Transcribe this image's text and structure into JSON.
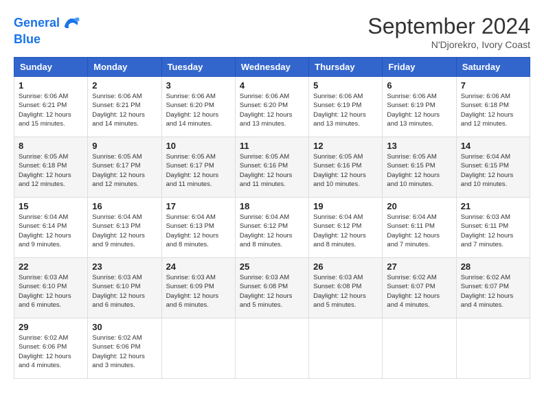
{
  "logo": {
    "line1": "General",
    "line2": "Blue"
  },
  "title": "September 2024",
  "location": "N'Djorekro, Ivory Coast",
  "days_of_week": [
    "Sunday",
    "Monday",
    "Tuesday",
    "Wednesday",
    "Thursday",
    "Friday",
    "Saturday"
  ],
  "weeks": [
    [
      {
        "day": "1",
        "sunrise": "6:06 AM",
        "sunset": "6:21 PM",
        "daylight": "12 hours and 15 minutes."
      },
      {
        "day": "2",
        "sunrise": "6:06 AM",
        "sunset": "6:21 PM",
        "daylight": "12 hours and 14 minutes."
      },
      {
        "day": "3",
        "sunrise": "6:06 AM",
        "sunset": "6:20 PM",
        "daylight": "12 hours and 14 minutes."
      },
      {
        "day": "4",
        "sunrise": "6:06 AM",
        "sunset": "6:20 PM",
        "daylight": "12 hours and 13 minutes."
      },
      {
        "day": "5",
        "sunrise": "6:06 AM",
        "sunset": "6:19 PM",
        "daylight": "12 hours and 13 minutes."
      },
      {
        "day": "6",
        "sunrise": "6:06 AM",
        "sunset": "6:19 PM",
        "daylight": "12 hours and 13 minutes."
      },
      {
        "day": "7",
        "sunrise": "6:06 AM",
        "sunset": "6:18 PM",
        "daylight": "12 hours and 12 minutes."
      }
    ],
    [
      {
        "day": "8",
        "sunrise": "6:05 AM",
        "sunset": "6:18 PM",
        "daylight": "12 hours and 12 minutes."
      },
      {
        "day": "9",
        "sunrise": "6:05 AM",
        "sunset": "6:17 PM",
        "daylight": "12 hours and 12 minutes."
      },
      {
        "day": "10",
        "sunrise": "6:05 AM",
        "sunset": "6:17 PM",
        "daylight": "12 hours and 11 minutes."
      },
      {
        "day": "11",
        "sunrise": "6:05 AM",
        "sunset": "6:16 PM",
        "daylight": "12 hours and 11 minutes."
      },
      {
        "day": "12",
        "sunrise": "6:05 AM",
        "sunset": "6:16 PM",
        "daylight": "12 hours and 10 minutes."
      },
      {
        "day": "13",
        "sunrise": "6:05 AM",
        "sunset": "6:15 PM",
        "daylight": "12 hours and 10 minutes."
      },
      {
        "day": "14",
        "sunrise": "6:04 AM",
        "sunset": "6:15 PM",
        "daylight": "12 hours and 10 minutes."
      }
    ],
    [
      {
        "day": "15",
        "sunrise": "6:04 AM",
        "sunset": "6:14 PM",
        "daylight": "12 hours and 9 minutes."
      },
      {
        "day": "16",
        "sunrise": "6:04 AM",
        "sunset": "6:13 PM",
        "daylight": "12 hours and 9 minutes."
      },
      {
        "day": "17",
        "sunrise": "6:04 AM",
        "sunset": "6:13 PM",
        "daylight": "12 hours and 8 minutes."
      },
      {
        "day": "18",
        "sunrise": "6:04 AM",
        "sunset": "6:12 PM",
        "daylight": "12 hours and 8 minutes."
      },
      {
        "day": "19",
        "sunrise": "6:04 AM",
        "sunset": "6:12 PM",
        "daylight": "12 hours and 8 minutes."
      },
      {
        "day": "20",
        "sunrise": "6:04 AM",
        "sunset": "6:11 PM",
        "daylight": "12 hours and 7 minutes."
      },
      {
        "day": "21",
        "sunrise": "6:03 AM",
        "sunset": "6:11 PM",
        "daylight": "12 hours and 7 minutes."
      }
    ],
    [
      {
        "day": "22",
        "sunrise": "6:03 AM",
        "sunset": "6:10 PM",
        "daylight": "12 hours and 6 minutes."
      },
      {
        "day": "23",
        "sunrise": "6:03 AM",
        "sunset": "6:10 PM",
        "daylight": "12 hours and 6 minutes."
      },
      {
        "day": "24",
        "sunrise": "6:03 AM",
        "sunset": "6:09 PM",
        "daylight": "12 hours and 6 minutes."
      },
      {
        "day": "25",
        "sunrise": "6:03 AM",
        "sunset": "6:08 PM",
        "daylight": "12 hours and 5 minutes."
      },
      {
        "day": "26",
        "sunrise": "6:03 AM",
        "sunset": "6:08 PM",
        "daylight": "12 hours and 5 minutes."
      },
      {
        "day": "27",
        "sunrise": "6:02 AM",
        "sunset": "6:07 PM",
        "daylight": "12 hours and 4 minutes."
      },
      {
        "day": "28",
        "sunrise": "6:02 AM",
        "sunset": "6:07 PM",
        "daylight": "12 hours and 4 minutes."
      }
    ],
    [
      {
        "day": "29",
        "sunrise": "6:02 AM",
        "sunset": "6:06 PM",
        "daylight": "12 hours and 4 minutes."
      },
      {
        "day": "30",
        "sunrise": "6:02 AM",
        "sunset": "6:06 PM",
        "daylight": "12 hours and 3 minutes."
      },
      null,
      null,
      null,
      null,
      null
    ]
  ]
}
